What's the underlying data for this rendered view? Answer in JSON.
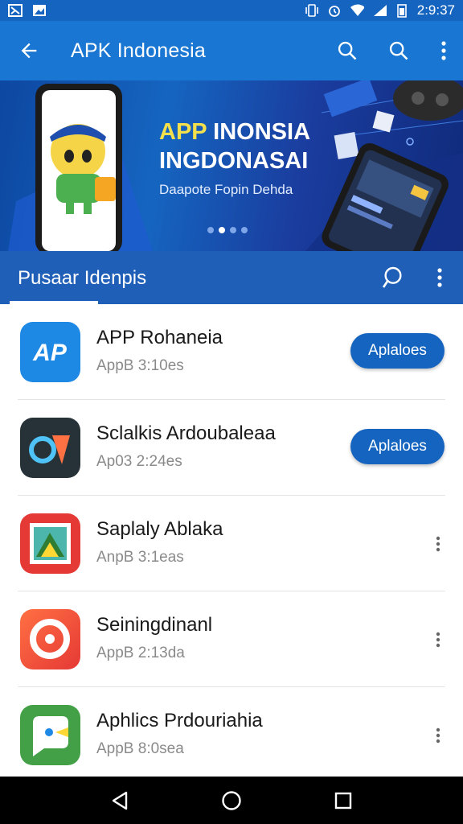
{
  "status_bar": {
    "time": "2:9:37"
  },
  "app_bar": {
    "title": "APK Indonesia"
  },
  "banner": {
    "headline_line1_highlight": "APP",
    "headline_line1_rest": " INONSIA",
    "headline_line2": "INGDONASAI",
    "subtitle": "Daapote Fopin Dehda",
    "pager_total": 4,
    "pager_active": 1
  },
  "section": {
    "tab_label": "Pusaar Idenpis"
  },
  "apps": [
    {
      "name": "APP Rohaneia",
      "meta": "AppB 3:10es",
      "action": "Aplaloes",
      "icon": "ap-logo-icon",
      "color": "#1e88e5"
    },
    {
      "name": "Sclalkis Ardoubaleaa",
      "meta": "Ap03 2:24es",
      "action": "Aplaloes",
      "icon": "map-pin-logo-icon",
      "color": "#263238"
    },
    {
      "name": "Saplaly Ablaka",
      "meta": "AnpB 3:1eas",
      "action": null,
      "icon": "photo-frame-logo-icon",
      "color": "#e53935"
    },
    {
      "name": "Seiningdinanl",
      "meta": "AppB 2:13da",
      "action": null,
      "icon": "camera-ring-logo-icon",
      "color": "#f4511e"
    },
    {
      "name": "Aphlics Prdouriahia",
      "meta": "AppB 8:0sea",
      "action": null,
      "icon": "chat-bubble-logo-icon",
      "color": "#43a047"
    }
  ],
  "nav_bar": {
    "buttons": [
      "back-icon",
      "home-icon",
      "recents-icon"
    ]
  }
}
